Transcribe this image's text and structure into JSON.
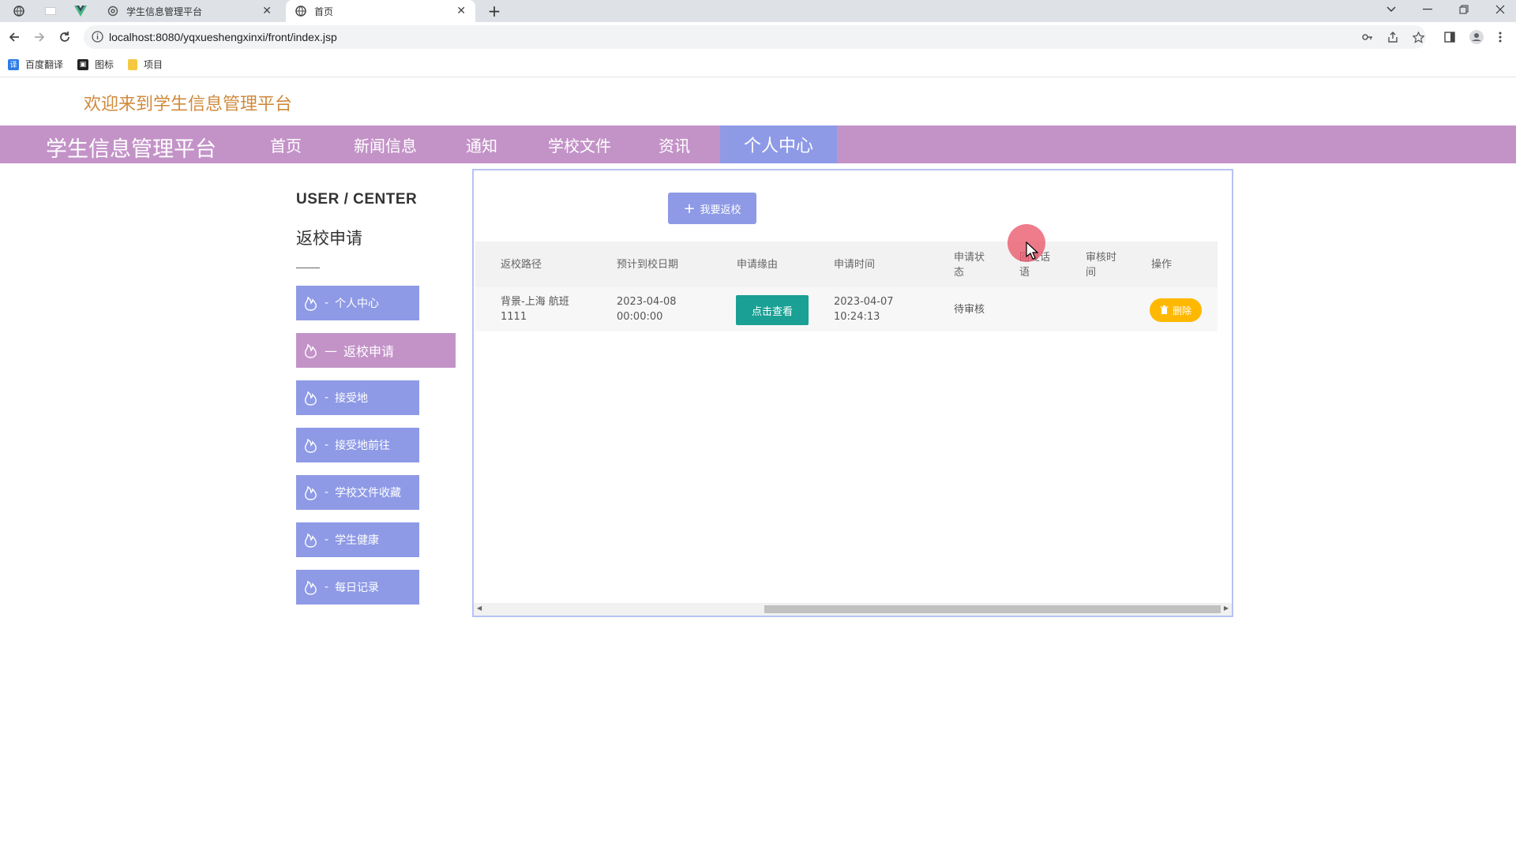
{
  "browser": {
    "tabs": [
      {
        "title": "学生信息管理平台",
        "close": "✕"
      },
      {
        "title": "首页",
        "close": "✕"
      }
    ],
    "new_tab": "+",
    "url": "localhost:8080/yqxueshengxinxi/front/index.jsp",
    "bookmarks": [
      "百度翻译",
      "图标",
      "项目"
    ]
  },
  "page": {
    "welcome": "欢迎来到学生信息管理平台",
    "brand": "学生信息管理平台",
    "nav": [
      "首页",
      "新闻信息",
      "通知",
      "学校文件",
      "资讯",
      "个人中心"
    ],
    "active_nav": "个人中心"
  },
  "sidebar": {
    "title": "USER / CENTER",
    "subtitle": "返校申请",
    "items": [
      {
        "label": "个人中心",
        "dash": "-"
      },
      {
        "label": "返校申请",
        "dash": "—"
      },
      {
        "label": "接受地",
        "dash": "-"
      },
      {
        "label": "接受地前往",
        "dash": "-"
      },
      {
        "label": "学校文件收藏",
        "dash": "-"
      },
      {
        "label": "学生健康",
        "dash": "-"
      },
      {
        "label": "每日记录",
        "dash": "-"
      }
    ],
    "active_item": "返校申请"
  },
  "content": {
    "add_button": "我要返校",
    "columns": [
      "返校路径",
      "预计到校日期",
      "申请缘由",
      "申请时间",
      "申请状态",
      "回复话语",
      "审核时间",
      "操作"
    ],
    "rows": [
      {
        "path": "背景-上海 航班1111",
        "expected_date": "2023-04-08 00:00:00",
        "reason_button": "点击查看",
        "apply_time": "2023-04-07 10:24:13",
        "status": "待审核",
        "reply": "",
        "review_time": "",
        "delete_button": "删除"
      }
    ]
  },
  "colors": {
    "nav_bg": "#c393c8",
    "accent_blue": "#8e9ae6",
    "welcome_text": "#d08a3c",
    "view_button": "#1aa094",
    "delete_button": "#ffb800"
  }
}
